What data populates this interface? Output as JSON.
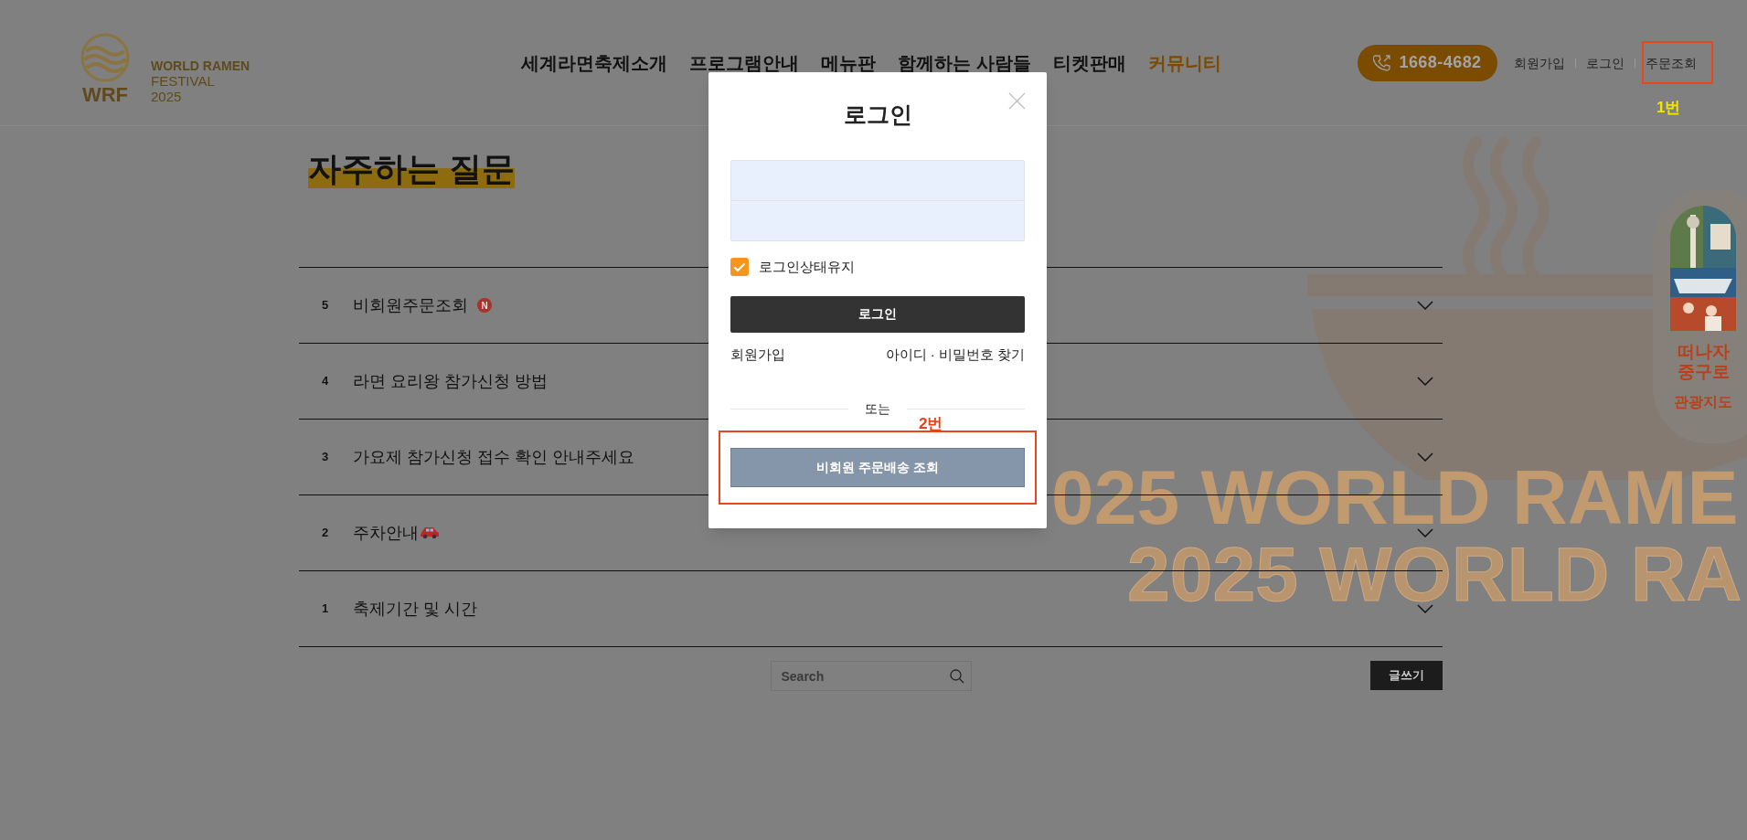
{
  "header": {
    "logo": {
      "mark": "WRF",
      "lines": [
        "WORLD RAMEN",
        "FESTIVAL",
        "2025"
      ]
    },
    "nav": [
      {
        "label": "세계라면축제소개",
        "selected": false
      },
      {
        "label": "프로그램안내",
        "selected": false
      },
      {
        "label": "메뉴판",
        "selected": false
      },
      {
        "label": "함께하는 사람들",
        "selected": false
      },
      {
        "label": "티켓판매",
        "selected": false
      },
      {
        "label": "커뮤니티",
        "selected": true
      }
    ],
    "phone": "1668-4682",
    "links": [
      {
        "label": "회원가입"
      },
      {
        "label": "로그인"
      },
      {
        "label": "주문조회",
        "annotation": {
          "label": "1번",
          "color": "#f5e400"
        }
      }
    ]
  },
  "page_title": "자주하는 질문",
  "faq": [
    {
      "number": "5",
      "title": "비회원주문조회",
      "badge": "N",
      "expanded": false
    },
    {
      "number": "4",
      "title": "라면 요리왕 참가신청 방법",
      "expanded": false
    },
    {
      "number": "3",
      "title": "가요제 참가신청 접수 확인 안내주세요",
      "expanded": false
    },
    {
      "number": "2",
      "title": "주차안내",
      "trailing_car": true,
      "expanded": false
    },
    {
      "number": "1",
      "title": "축제기간 및 시간",
      "expanded": false
    }
  ],
  "search": {
    "placeholder": "Search"
  },
  "write_button": "글쓰기",
  "background_text": [
    "025 WORLD RAME",
    "2025 WORLD RA"
  ],
  "side_banner": {
    "title_lines": [
      "떠나자",
      "중구로"
    ],
    "subtitle": "관광지도"
  },
  "login_modal": {
    "title": "로그인",
    "keep_logged_in": {
      "label": "로그인상태유지",
      "checked": true
    },
    "submit": "로그인",
    "links": [
      "회원가입",
      "아이디 · 비밀번호 찾기"
    ],
    "divider": "또는",
    "guest_button": {
      "label": "비회원 주문배송 조회",
      "annotation": {
        "label": "2번",
        "color": "#ea4019"
      }
    }
  }
}
